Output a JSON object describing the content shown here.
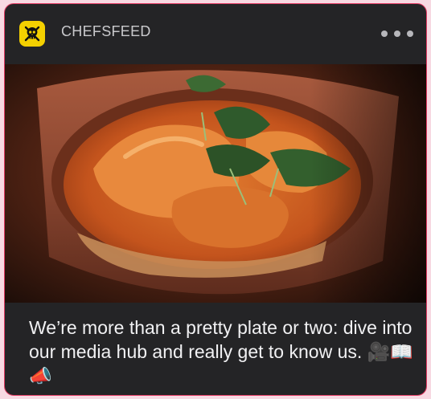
{
  "notification": {
    "app_name": "CHEFSFEED",
    "app_icon": "chef-skull-crossed-utensils-icon",
    "more_icon": "ellipsis-icon",
    "image_subject": "bowl of seafood curry soup with microgreens",
    "caption": "We’re more than a pretty plate or two: dive into our media hub and really get to know us. 🎥📖📣"
  },
  "colors": {
    "accent_border": "#e23a63",
    "background": "#f7d9e2",
    "card": "#242426",
    "app_icon": "#f4d000"
  }
}
